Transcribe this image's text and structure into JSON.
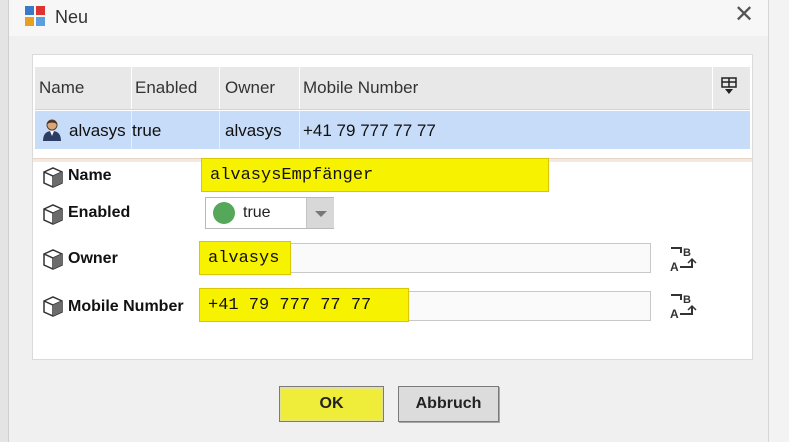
{
  "window": {
    "title": "Neu",
    "close_glyph": "✕"
  },
  "table": {
    "headers": [
      "Name",
      "Enabled",
      "Owner",
      "Mobile Number"
    ],
    "row": {
      "name": "alvasys",
      "enabled": "true",
      "owner": "alvasys",
      "mobile": "+41 79 777 77 77"
    }
  },
  "form": {
    "name": {
      "label": "Name",
      "value": "alvasysEmpfänger"
    },
    "enabled": {
      "label": "Enabled",
      "value": "true",
      "status_color": "#55a85a"
    },
    "owner": {
      "label": "Owner",
      "value": "alvasys"
    },
    "mobile": {
      "label": "Mobile Number",
      "value": "+41 79 777 77 77"
    }
  },
  "buttons": {
    "ok": "OK",
    "cancel": "Abbruch"
  },
  "colors": {
    "selection": "#c7dcf8",
    "highlight": "#f7f200"
  },
  "icons": [
    "app-icon",
    "close-icon",
    "column-chooser-icon",
    "user-icon",
    "cube-icon",
    "dropdown-arrow-icon",
    "rename-ab-icon"
  ]
}
